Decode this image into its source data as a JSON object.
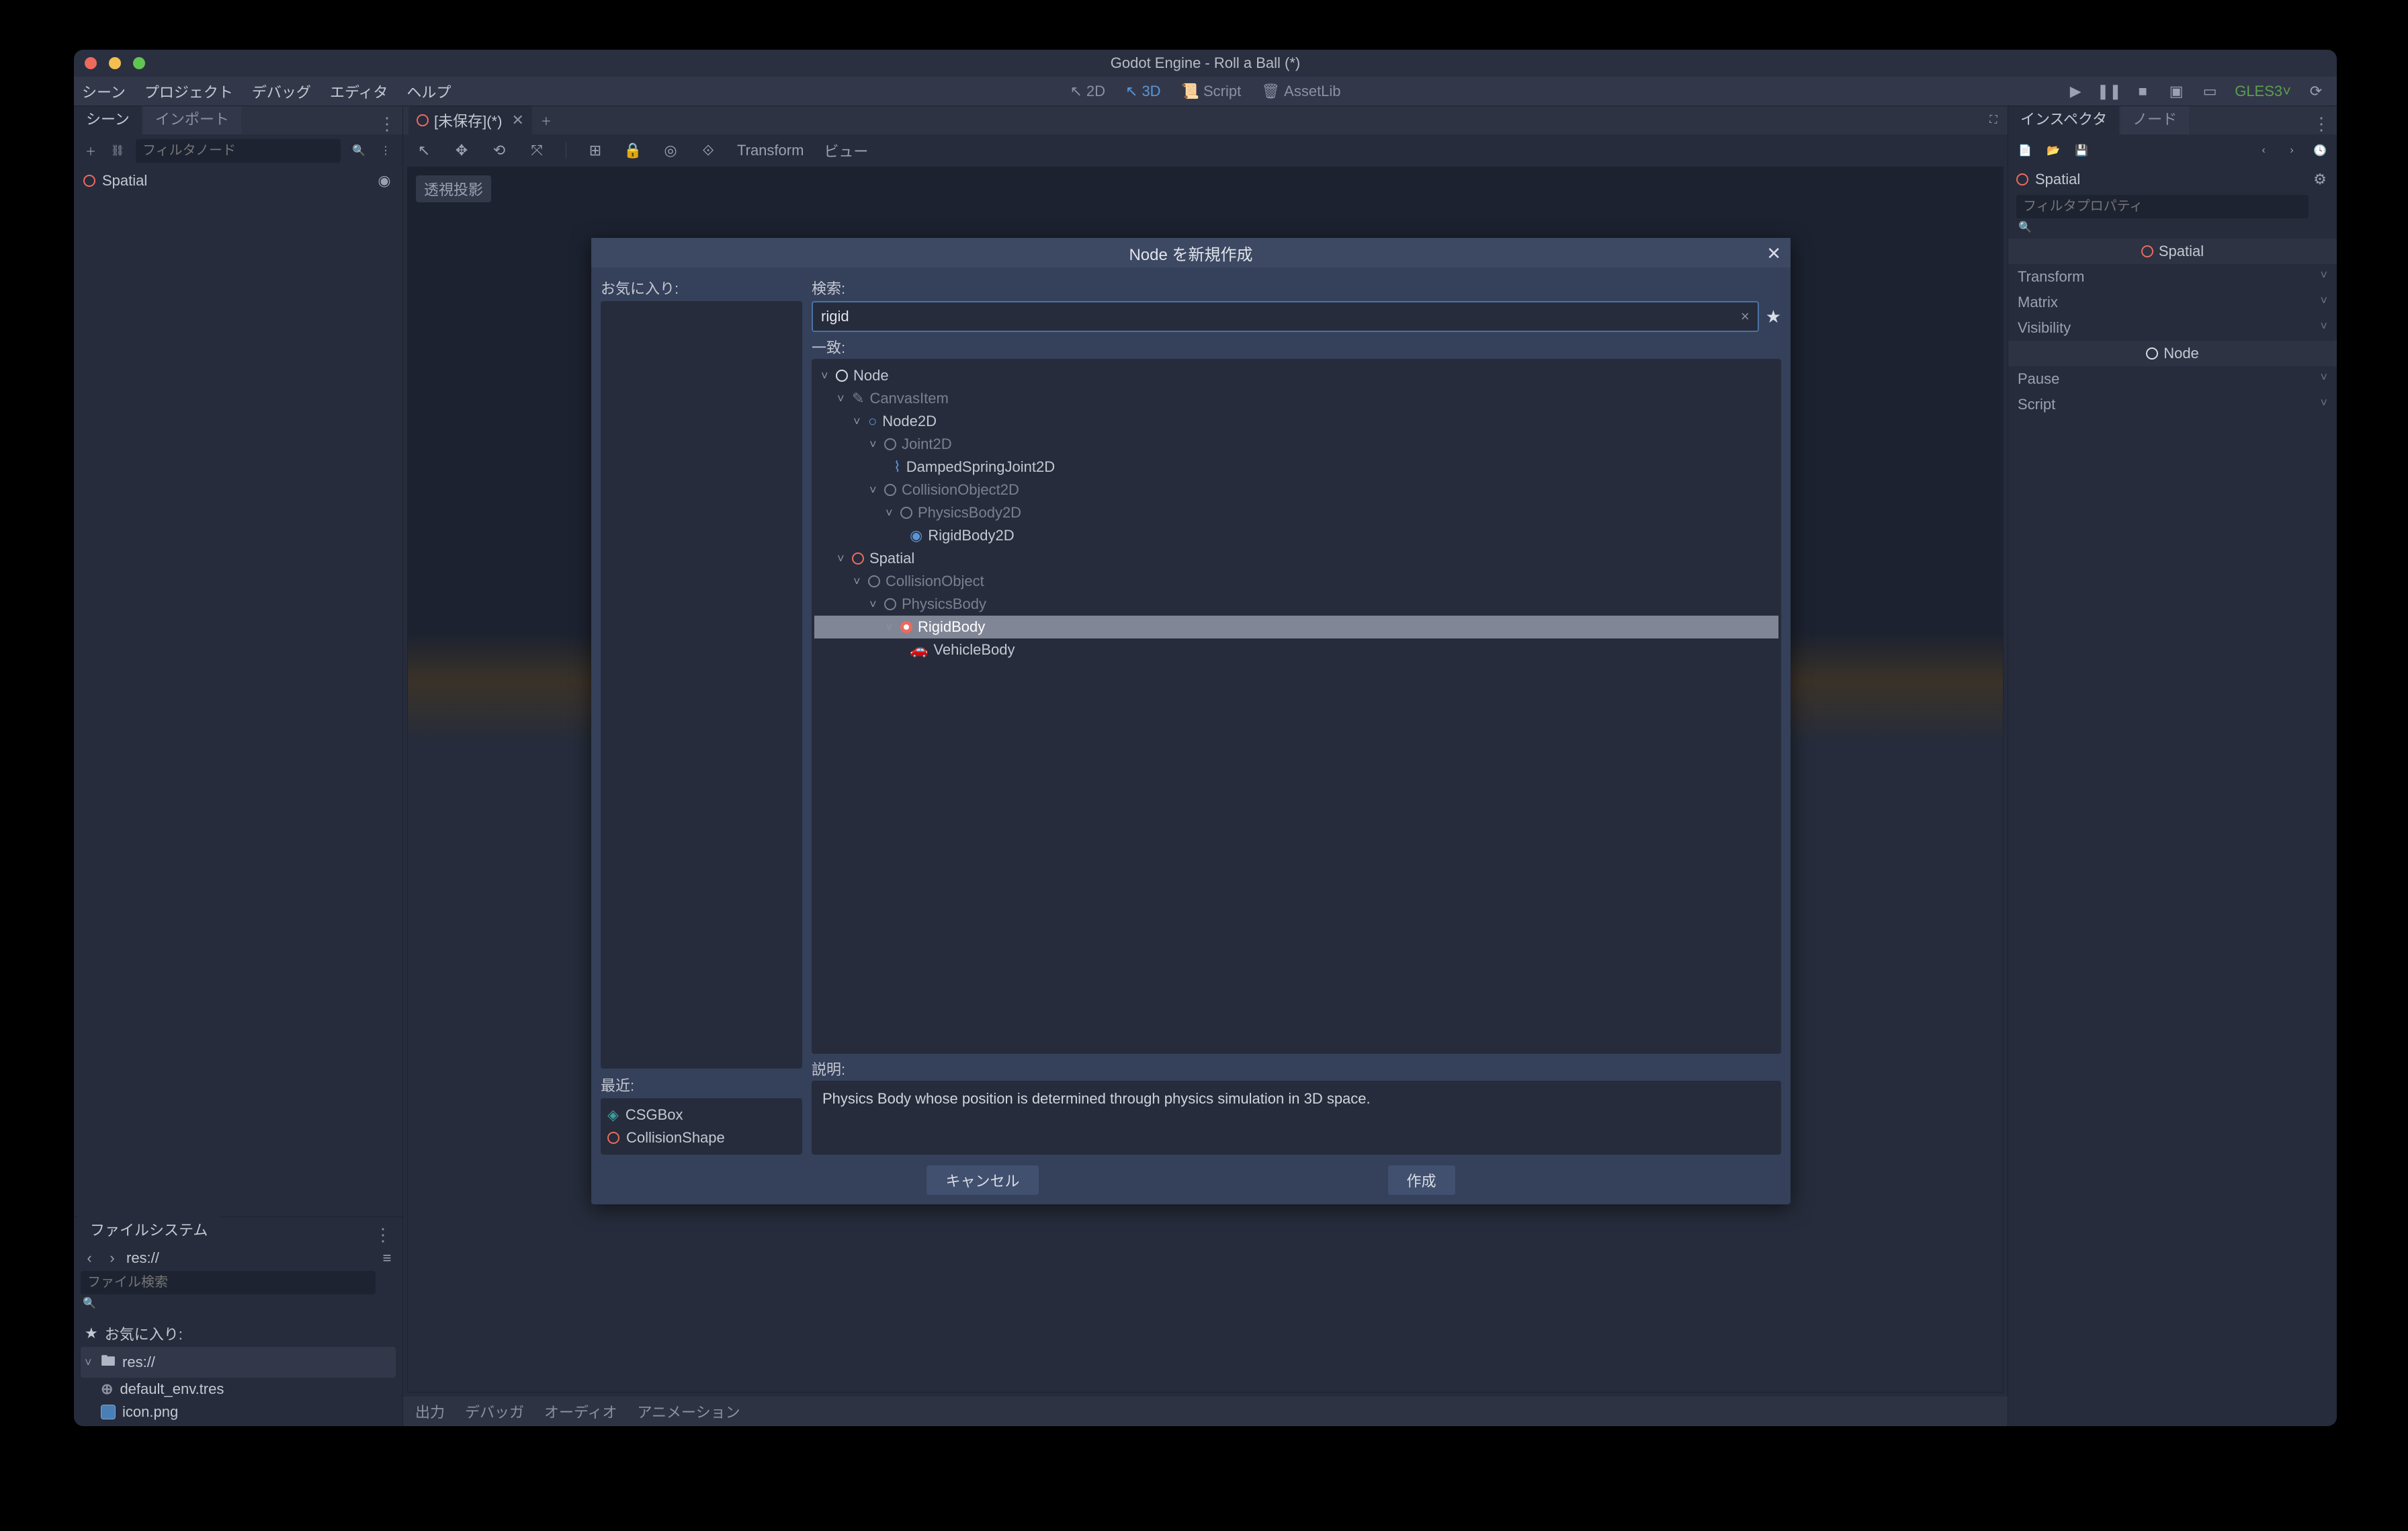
{
  "window": {
    "title": "Godot Engine - Roll a Ball (*)"
  },
  "menubar": {
    "scene": "シーン",
    "project": "プロジェクト",
    "debug": "デバッグ",
    "editor": "エディタ",
    "help": "ヘルプ"
  },
  "switcher": {
    "2d": "2D",
    "3d": "3D",
    "script": "Script",
    "assetlib": "AssetLib"
  },
  "topright": {
    "gles": "GLES3"
  },
  "left": {
    "tabs": {
      "scene": "シーン",
      "import": "インポート"
    },
    "filter_placeholder": "フィルタノード",
    "root_node": "Spatial",
    "fs_tab": "ファイルシステム",
    "fs_path": "res://",
    "fs_search_placeholder": "ファイル検索",
    "fs_fav": "お気に入り:",
    "fs_root": "res://",
    "fs_items": [
      "default_env.tres",
      "icon.png"
    ]
  },
  "center": {
    "scene_tab": "[未保存](*)",
    "toolbar": {
      "transform": "Transform",
      "view": "ビュー"
    },
    "projection": "透視投影"
  },
  "bottom": {
    "output": "出力",
    "debugger": "デバッガ",
    "audio": "オーディオ",
    "animation": "アニメーション"
  },
  "right": {
    "tabs": {
      "inspector": "インスペクタ",
      "node": "ノード"
    },
    "node": "Spatial",
    "filter_placeholder": "フィルタプロパティ",
    "section_spatial": "Spatial",
    "props_spatial": [
      "Transform",
      "Matrix",
      "Visibility"
    ],
    "section_node": "Node",
    "props_node": [
      "Pause",
      "Script"
    ]
  },
  "dialog": {
    "title": "Node を新規作成",
    "favorites_label": "お気に入り:",
    "recent_label": "最近:",
    "recent": [
      "CSGBox",
      "CollisionShape"
    ],
    "search_label": "検索:",
    "search_value": "rigid",
    "match_label": "一致:",
    "tree": {
      "node": "Node",
      "canvasitem": "CanvasItem",
      "node2d": "Node2D",
      "joint2d": "Joint2D",
      "dampedspring": "DampedSpringJoint2D",
      "collobj2d": "CollisionObject2D",
      "physbody2d": "PhysicsBody2D",
      "rigidbody2d": "RigidBody2D",
      "spatial": "Spatial",
      "collobj": "CollisionObject",
      "physbody": "PhysicsBody",
      "rigidbody": "RigidBody",
      "vehiclebody": "VehicleBody"
    },
    "desc_label": "説明:",
    "description": "Physics Body whose position is determined through physics simulation in 3D space.",
    "cancel": "キャンセル",
    "create": "作成"
  }
}
